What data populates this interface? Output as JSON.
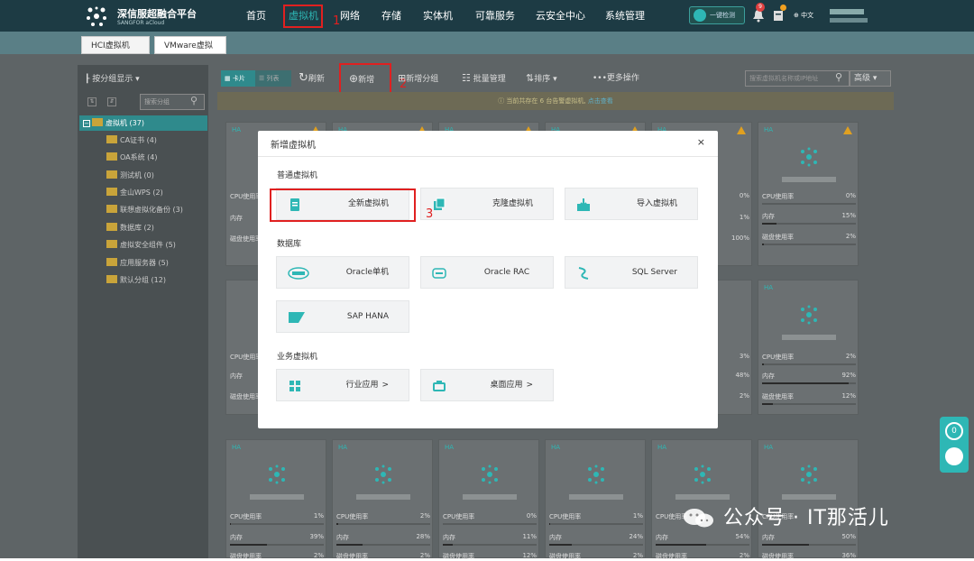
{
  "header": {
    "brand": "深信服超融合平台",
    "brand_sub": "SANGFOR aCloud",
    "nav": [
      "首页",
      "虚拟机",
      "网络",
      "存储",
      "实体机",
      "可靠服务",
      "云安全中心",
      "系统管理"
    ],
    "quick_button": "一键检测",
    "badge": "9",
    "lang": "中文"
  },
  "tabs": [
    "HCI虚拟机",
    "VMware虚拟机"
  ],
  "sidebar": {
    "group_display": "按分组显示",
    "search_placeholder": "搜索分组",
    "root": "虚拟机 (37)",
    "items": [
      "CA证书 (4)",
      "OA系统 (4)",
      "测试机 (0)",
      "金山WPS (2)",
      "联想虚拟化备份 (3)",
      "数据库 (2)",
      "虚拟安全组件 (5)",
      "应用服务器 (5)",
      "默认分组 (12)"
    ]
  },
  "toolbar": {
    "card": "卡片",
    "list": "列表",
    "refresh": "刷新",
    "new": "新增",
    "new_group": "新增分组",
    "batch": "批量管理",
    "sort": "排序",
    "more": "•••更多操作",
    "search_placeholder": "搜索虚拟机名称或IP地址",
    "advanced": "高级"
  },
  "notice": {
    "text": "当前共存在 6 台告警虚拟机,",
    "link": "点击查看"
  },
  "annotations": [
    "1",
    "2",
    "3"
  ],
  "modal": {
    "title": "新增虚拟机",
    "close": "×",
    "sections": {
      "general": "普通虚拟机",
      "database": "数据库",
      "business": "业务虚拟机"
    },
    "general_options": [
      "全新虚拟机",
      "克隆虚拟机",
      "导入虚拟机"
    ],
    "database_options": [
      "Oracle单机",
      "Oracle RAC",
      "SQL Server",
      "SAP HANA"
    ],
    "business_options": [
      "行业应用",
      "桌面应用"
    ],
    "arrow": ">"
  },
  "cards": {
    "ha": "HA",
    "labels": {
      "cpu": "CPU使用率",
      "mem": "内存",
      "disk": "磁盘使用率"
    },
    "row1_right": [
      {
        "cpu": "0%",
        "mem": "1%",
        "disk": "100%"
      },
      {
        "cpu": "0%",
        "mem": "15%",
        "disk": "2%"
      }
    ],
    "row2_right": [
      {
        "cpu": "3%",
        "mem": "48%",
        "disk": "2%"
      },
      {
        "cpu": "2%",
        "mem": "92%",
        "disk": "12%"
      }
    ],
    "row3": [
      {
        "cpu": "1%",
        "mem": "39%",
        "disk": "2%"
      },
      {
        "cpu": "2%",
        "mem": "28%",
        "disk": "2%"
      },
      {
        "cpu": "0%",
        "mem": "11%",
        "disk": "12%"
      },
      {
        "cpu": "1%",
        "mem": "24%",
        "disk": "2%"
      },
      {
        "cpu": "",
        "mem": "54%",
        "disk": "2%"
      },
      {
        "cpu": "",
        "mem": "50%",
        "disk": "36%"
      }
    ]
  },
  "watermark": "公众号 · IT那活儿",
  "colors": {
    "accent": "#2eb7b5",
    "highlight": "#e02020",
    "topbar": "#1d3b44"
  }
}
